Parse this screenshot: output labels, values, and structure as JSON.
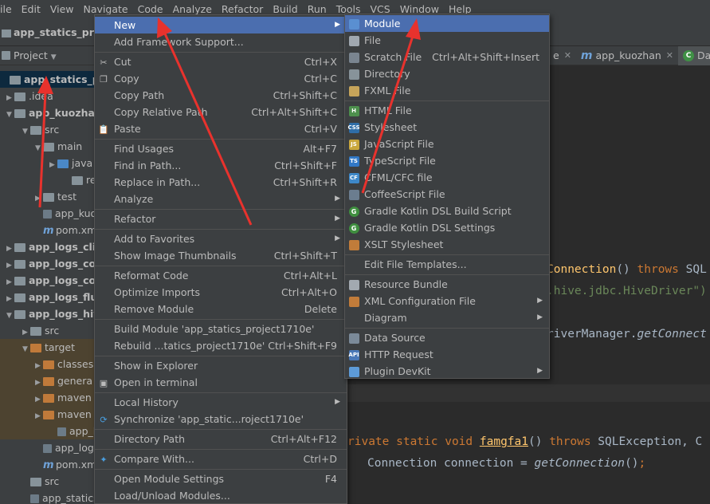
{
  "menubar": [
    "ile",
    "Edit",
    "View",
    "Navigate",
    "Code",
    "Analyze",
    "Refactor",
    "Build",
    "Run",
    "Tools",
    "VCS",
    "Window",
    "Help"
  ],
  "breadcrumb": "app_statics_proje",
  "project_tool": {
    "label": "Project"
  },
  "tree": [
    {
      "label": "app_statics_pro",
      "y": 0
    },
    {
      "label": ".idea"
    },
    {
      "label": "app_kuozha"
    },
    {
      "label": "src"
    },
    {
      "label": "main"
    },
    {
      "label": "java"
    },
    {
      "label": "res"
    },
    {
      "label": "test"
    },
    {
      "label": "app_kuoz"
    },
    {
      "label": "pom.xml"
    },
    {
      "label": "app_logs_cli"
    },
    {
      "label": "app_logs_co"
    },
    {
      "label": "app_logs_co"
    },
    {
      "label": "app_logs_flu"
    },
    {
      "label": "app_logs_hiv"
    },
    {
      "label": "src"
    },
    {
      "label": "target"
    },
    {
      "label": "classes"
    },
    {
      "label": "genera"
    },
    {
      "label": "maven"
    },
    {
      "label": "maven"
    },
    {
      "label": "app_lo"
    },
    {
      "label": "app_logs"
    },
    {
      "label": "pom.xml"
    },
    {
      "label": "src"
    },
    {
      "label": "app_statics_p"
    }
  ],
  "tabs": [
    {
      "label": "e"
    },
    {
      "label": "app_kuozhan"
    },
    {
      "label": "Day"
    }
  ],
  "code": {
    "line1_fn": "Connection",
    "line1_rest": "() ",
    "line1_kw": "throws",
    "line1_tail": " SQL",
    "line2_str": ".hive.jdbc.HiveDriver\")",
    "line3_a": "riverManager.",
    "line3_b": "getConnect",
    "line4_kw1": "rivate static void ",
    "line4_fn": "famgfa1",
    "line4_mid": "() ",
    "line4_kw2": "throws",
    "line4_tail": " SQLException, C",
    "line5_a": "Connection connection = ",
    "line5_b": "getConnection",
    "line5_c": "()",
    "line5_d": ";"
  },
  "context_menu": [
    {
      "label": "New",
      "shortcut": "",
      "submenu": true,
      "icon": ""
    },
    {
      "label": "Add Framework Support...",
      "shortcut": "",
      "icon": ""
    },
    {
      "sep": true
    },
    {
      "label": "Cut",
      "shortcut": "Ctrl+X",
      "icon": "scissors-icon"
    },
    {
      "label": "Copy",
      "shortcut": "Ctrl+C",
      "icon": "copy-icon"
    },
    {
      "label": "Copy Path",
      "shortcut": "Ctrl+Shift+C",
      "icon": ""
    },
    {
      "label": "Copy Relative Path",
      "shortcut": "Ctrl+Alt+Shift+C",
      "icon": ""
    },
    {
      "label": "Paste",
      "shortcut": "Ctrl+V",
      "icon": "paste-icon"
    },
    {
      "sep": true
    },
    {
      "label": "Find Usages",
      "shortcut": "Alt+F7",
      "icon": ""
    },
    {
      "label": "Find in Path...",
      "shortcut": "Ctrl+Shift+F",
      "icon": ""
    },
    {
      "label": "Replace in Path...",
      "shortcut": "Ctrl+Shift+R",
      "icon": ""
    },
    {
      "label": "Analyze",
      "shortcut": "",
      "submenu": true,
      "icon": ""
    },
    {
      "sep": true
    },
    {
      "label": "Refactor",
      "shortcut": "",
      "submenu": true,
      "icon": ""
    },
    {
      "sep": true
    },
    {
      "label": "Add to Favorites",
      "shortcut": "",
      "submenu": true,
      "icon": ""
    },
    {
      "label": "Show Image Thumbnails",
      "shortcut": "Ctrl+Shift+T",
      "icon": ""
    },
    {
      "sep": true
    },
    {
      "label": "Reformat Code",
      "shortcut": "Ctrl+Alt+L",
      "icon": ""
    },
    {
      "label": "Optimize Imports",
      "shortcut": "Ctrl+Alt+O",
      "icon": ""
    },
    {
      "label": "Remove Module",
      "shortcut": "Delete",
      "icon": ""
    },
    {
      "sep": true
    },
    {
      "label": "Build Module 'app_statics_project1710e'",
      "shortcut": "",
      "icon": ""
    },
    {
      "label": "Rebuild ...tatics_project1710e'",
      "shortcut": "Ctrl+Shift+F9",
      "icon": ""
    },
    {
      "sep": true
    },
    {
      "label": "Show in Explorer",
      "shortcut": "",
      "icon": ""
    },
    {
      "label": "Open in terminal",
      "shortcut": "",
      "icon": "terminal-icon"
    },
    {
      "sep": true
    },
    {
      "label": "Local History",
      "shortcut": "",
      "submenu": true,
      "icon": ""
    },
    {
      "label": "Synchronize 'app_static...roject1710e'",
      "shortcut": "",
      "icon": "sync-icon"
    },
    {
      "sep": true
    },
    {
      "label": "Directory Path",
      "shortcut": "Ctrl+Alt+F12",
      "icon": ""
    },
    {
      "sep": true
    },
    {
      "label": "Compare With...",
      "shortcut": "Ctrl+D",
      "icon": "compare-icon"
    },
    {
      "sep": true
    },
    {
      "label": "Open Module Settings",
      "shortcut": "F4",
      "icon": ""
    },
    {
      "label": "Load/Unload Modules...",
      "shortcut": "",
      "icon": ""
    }
  ],
  "sub_menu": [
    {
      "label": "Module",
      "shortcut": "",
      "icon": "module-icon"
    },
    {
      "label": "File",
      "shortcut": "",
      "icon": "file-icon"
    },
    {
      "label": "Scratch File",
      "shortcut": "Ctrl+Alt+Shift+Insert",
      "icon": "scratch-file-icon"
    },
    {
      "label": "Directory",
      "shortcut": "",
      "icon": "folder-icon"
    },
    {
      "label": "FXML File",
      "shortcut": "",
      "icon": "fxml-icon"
    },
    {
      "sep": true
    },
    {
      "label": "HTML File",
      "shortcut": "",
      "icon": "html-icon",
      "tag": "H"
    },
    {
      "label": "Stylesheet",
      "shortcut": "",
      "icon": "css-icon",
      "tag": "CSS"
    },
    {
      "label": "JavaScript File",
      "shortcut": "",
      "icon": "js-icon",
      "tag": "JS"
    },
    {
      "label": "TypeScript File",
      "shortcut": "",
      "icon": "ts-icon",
      "tag": "TS"
    },
    {
      "label": "CFML/CFC file",
      "shortcut": "",
      "icon": "cfml-icon",
      "tag": "CF"
    },
    {
      "label": "CoffeeScript File",
      "shortcut": "",
      "icon": "coffeescript-icon"
    },
    {
      "label": "Gradle Kotlin DSL Build Script",
      "shortcut": "",
      "icon": "gradle-icon",
      "tag": "G"
    },
    {
      "label": "Gradle Kotlin DSL Settings",
      "shortcut": "",
      "icon": "gradle-icon",
      "tag": "G"
    },
    {
      "label": "XSLT Stylesheet",
      "shortcut": "",
      "icon": "xslt-icon"
    },
    {
      "sep": true
    },
    {
      "label": "Edit File Templates...",
      "shortcut": "",
      "icon": ""
    },
    {
      "sep": true
    },
    {
      "label": "Resource Bundle",
      "shortcut": "",
      "icon": "resource-bundle-icon"
    },
    {
      "label": "XML Configuration File",
      "shortcut": "",
      "submenu": true,
      "icon": "xml-icon"
    },
    {
      "label": "Diagram",
      "shortcut": "",
      "submenu": true,
      "icon": ""
    },
    {
      "sep": true
    },
    {
      "label": "Data Source",
      "shortcut": "",
      "icon": "data-source-icon"
    },
    {
      "label": "HTTP Request",
      "shortcut": "",
      "icon": "http-request-icon",
      "tag": "API"
    },
    {
      "label": "Plugin DevKit",
      "shortcut": "",
      "submenu": true,
      "icon": "plugin-icon"
    }
  ],
  "colors": {
    "menu_bg": "#3c3f41",
    "highlight": "#4b6eaf",
    "editor_bg": "#2b2b2b",
    "annotation_arrow": "#e8322d"
  }
}
